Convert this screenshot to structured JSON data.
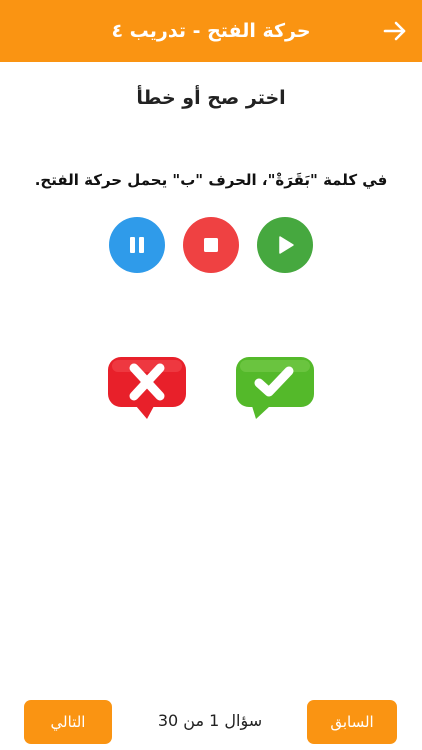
{
  "header": {
    "title": "حركة الفتح - تدريب ٤",
    "back_icon": "arrow-right-icon"
  },
  "colors": {
    "accent": "#FA9412",
    "pause": "#2F9BEA",
    "stop": "#EF4142",
    "play": "#46A83F",
    "false_answer": "#E8202A",
    "true_answer": "#54B92A"
  },
  "main": {
    "instruction": "اختر صح أو خطأ",
    "question": "في كلمة \"بَقَرَةْ\"، الحرف \"ب\" يحمل حركة الفتح.",
    "audio_controls": {
      "pause_icon": "pause-icon",
      "stop_icon": "stop-icon",
      "play_icon": "play-icon"
    },
    "answers": {
      "false_icon": "cross-icon",
      "true_icon": "check-icon"
    }
  },
  "footer": {
    "next_label": "التالي",
    "prev_label": "السابق",
    "counter": "سؤال 1 من 30"
  }
}
